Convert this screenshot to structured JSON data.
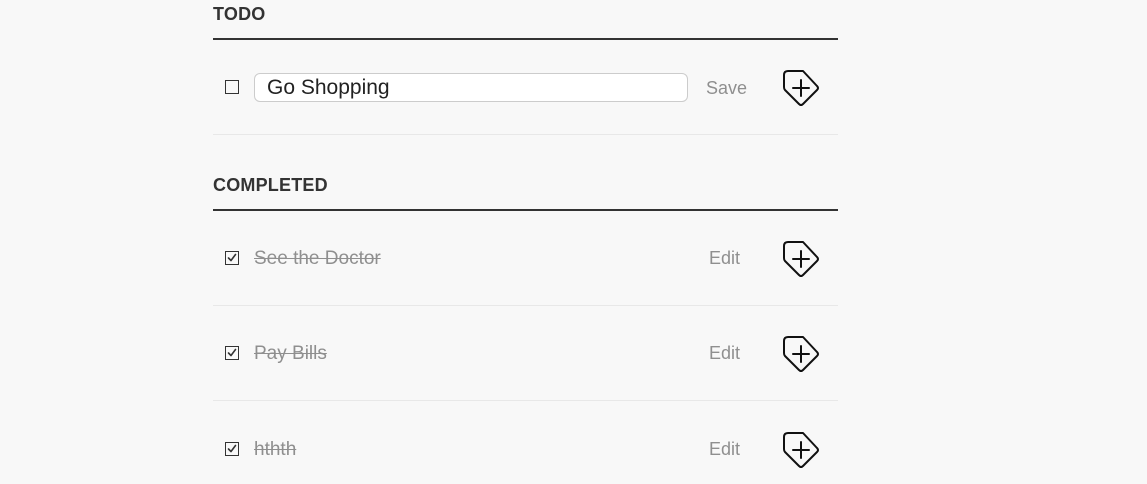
{
  "todo": {
    "heading": "TODO",
    "items": [
      {
        "value": "Go Shopping",
        "checked": false,
        "action_label": "Save",
        "editing": true
      }
    ]
  },
  "completed": {
    "heading": "COMPLETED",
    "items": [
      {
        "text": "See the Doctor",
        "checked": true,
        "action_label": "Edit"
      },
      {
        "text": "Pay Bills",
        "checked": true,
        "action_label": "Edit"
      },
      {
        "text": "hthth",
        "checked": true,
        "action_label": "Edit"
      }
    ]
  },
  "icons": {
    "add_tag": "tag-plus-icon",
    "checked": "checkmark-icon"
  },
  "colors": {
    "background": "#f8f8f8",
    "heading": "#333333",
    "muted_text": "#8f8f8f",
    "divider": "#e8e8e8"
  }
}
